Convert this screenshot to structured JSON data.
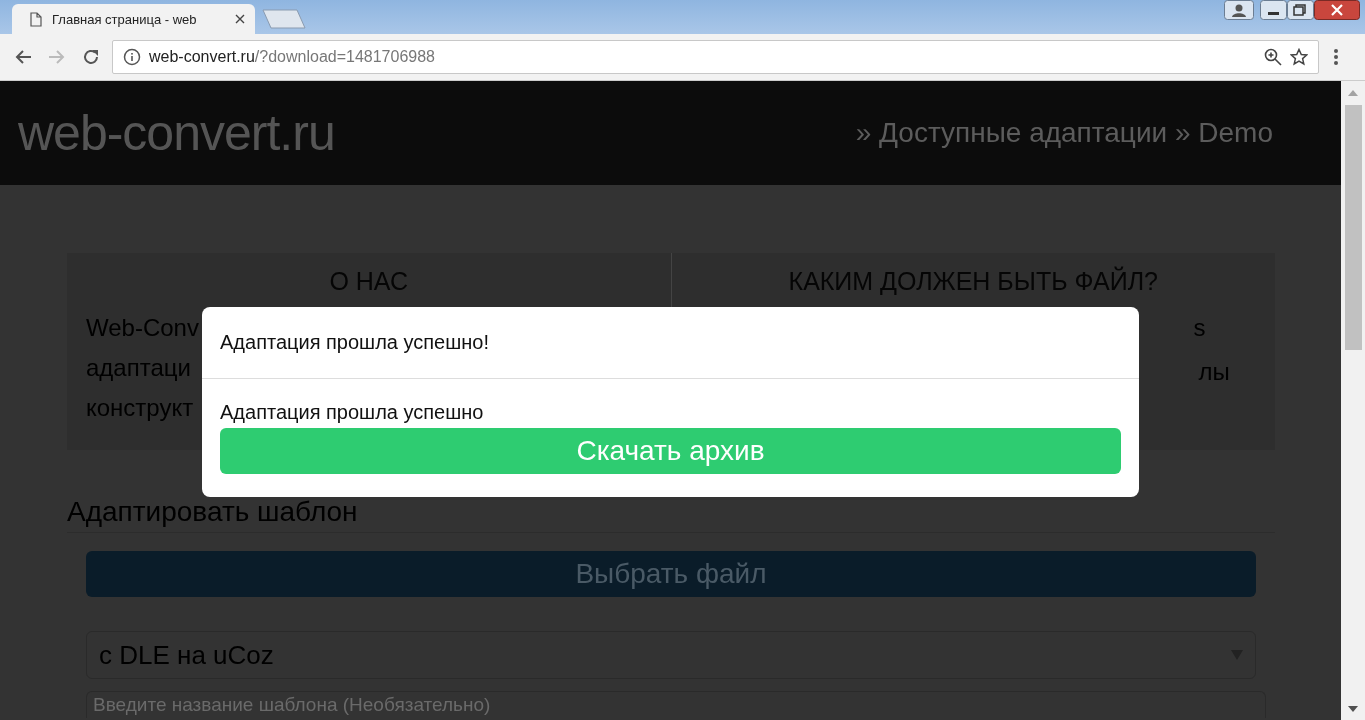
{
  "browser": {
    "tabs": [
      {
        "title": "Главная страница - web",
        "selected": true
      }
    ],
    "address": {
      "host": "web-convert.ru",
      "path": "/?download=1481706988"
    }
  },
  "header": {
    "logo": "web-convert.ru",
    "breadcrumbs": "» Доступные адаптации » Demo"
  },
  "info_columns": [
    {
      "heading": "О НАС",
      "lines": [
        "Web-Conv",
        "адаптаци",
        "конструкт"
      ]
    },
    {
      "heading": "КАКИМ ДОЛЖЕН БЫТЬ ФАЙЛ?",
      "lines": [
        "s",
        "лы"
      ]
    }
  ],
  "form": {
    "title": "Адаптировать шаблон",
    "file_button": "Выбрать файл",
    "conversion_select": "с DLE на uCoz",
    "name_field": {
      "placeholder": "Введите название шаблона (Необязательно)"
    }
  },
  "modal": {
    "title": "Адаптация прошла успешно!",
    "message": "Адаптация прошла успешно",
    "download_button": "Скачать архив"
  }
}
